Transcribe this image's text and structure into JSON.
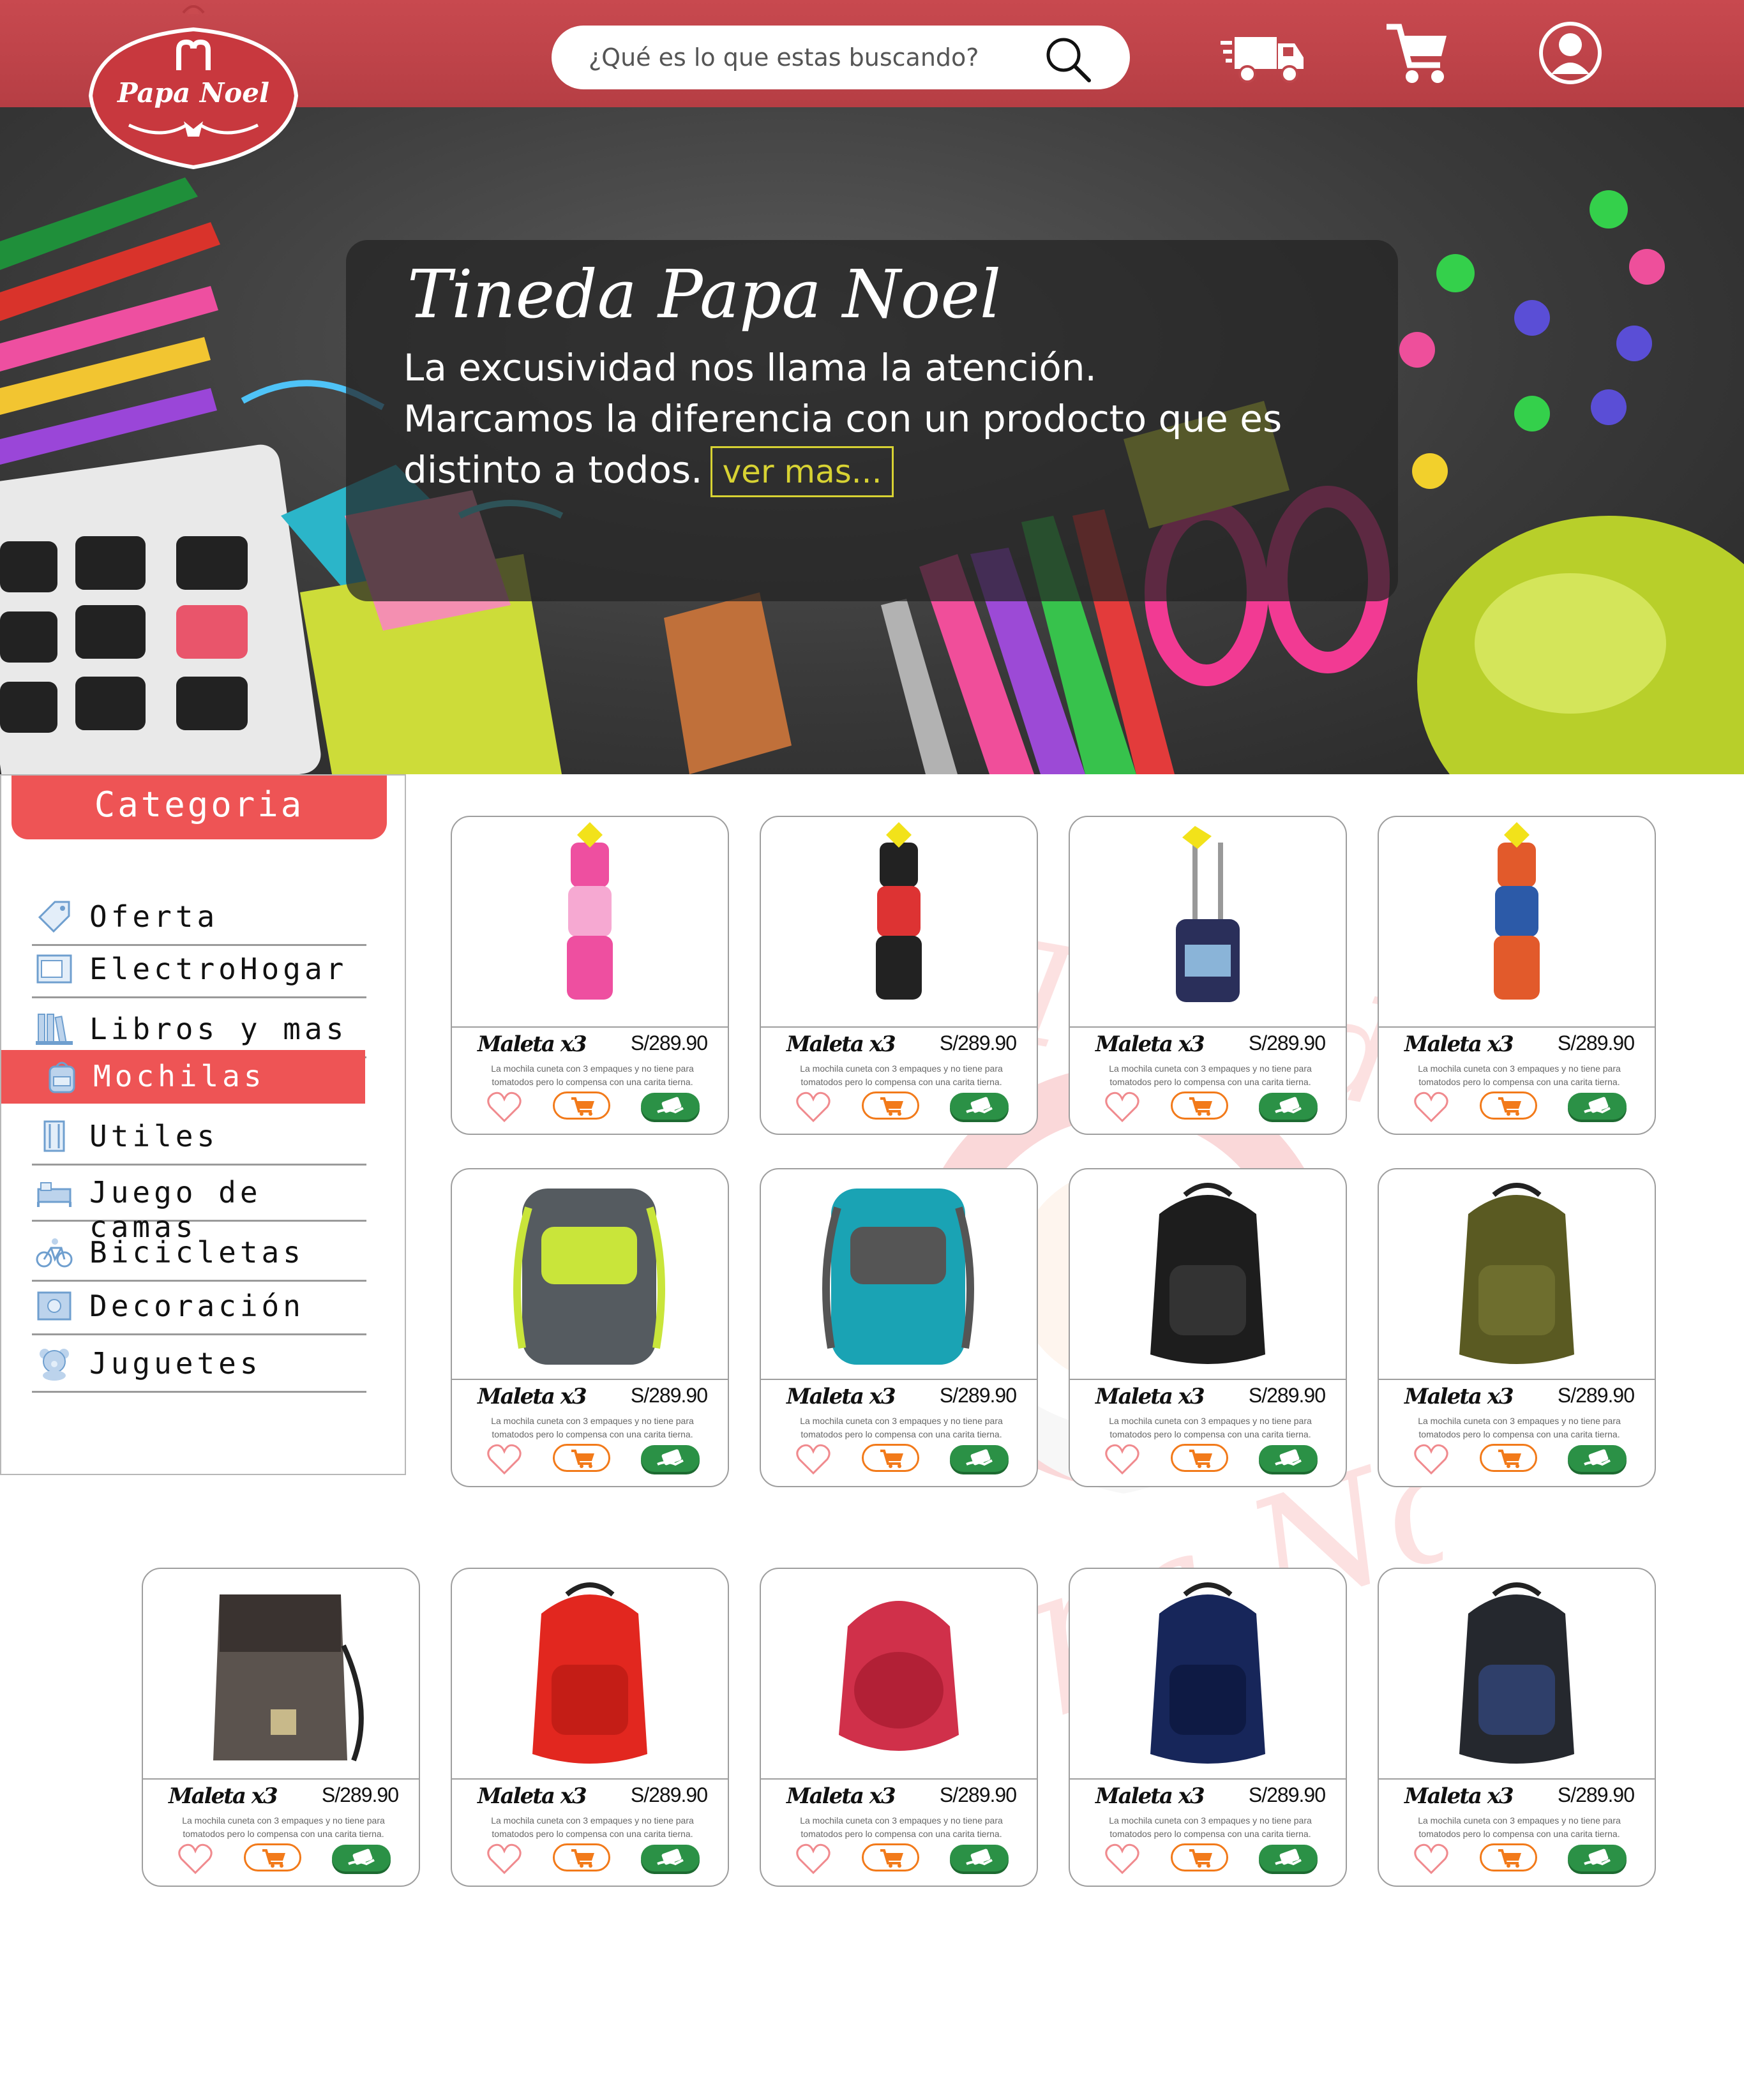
{
  "header": {
    "brand": "Papa Noel",
    "search_placeholder": "¿Qué es lo que estas buscando?",
    "icons": [
      "delivery-truck-icon",
      "cart-icon",
      "user-icon"
    ],
    "colors": {
      "bar": "#c0464c",
      "accent": "#ee5455",
      "buy": "#2b9146",
      "cart": "#f27a1a"
    }
  },
  "hero": {
    "title": "Tineda Papa Noel",
    "text": "La excusividad nos llama la atención. Marcamos la diferencia con un prodocto que es distinto a todos.",
    "cta": "ver mas..."
  },
  "sidebar": {
    "title": "Categoria",
    "items": [
      {
        "label": "Oferta",
        "icon": "tag-icon"
      },
      {
        "label": "ElectroHogar",
        "icon": "microwave-icon"
      },
      {
        "label": "Libros y mas",
        "icon": "books-icon"
      },
      {
        "label": "Mochilas",
        "icon": "backpack-icon",
        "active": true
      },
      {
        "label": "Utiles",
        "icon": "school-supplies-icon"
      },
      {
        "label": "Juego de camas",
        "icon": "bed-icon"
      },
      {
        "label": "Bicicletas",
        "icon": "bicycle-icon"
      },
      {
        "label": "Decoración",
        "icon": "frame-icon"
      },
      {
        "label": "Juguetes",
        "icon": "teddy-bear-icon"
      }
    ]
  },
  "products": [
    {
      "name": "Maleta x3",
      "price": "S/289.90",
      "desc": "La mochila cuneta con 3 empaques y no tiene para tomatodos pero lo compensa con una carita tierna."
    },
    {
      "name": "Maleta x3",
      "price": "S/289.90",
      "desc": "La mochila cuneta con 3 empaques y no tiene para tomatodos pero lo compensa con una carita tierna."
    },
    {
      "name": "Maleta x3",
      "price": "S/289.90",
      "desc": "La mochila cuneta con 3 empaques y no tiene para tomatodos pero lo compensa con una carita tierna."
    },
    {
      "name": "Maleta x3",
      "price": "S/289.90",
      "desc": "La mochila cuneta con 3 empaques y no tiene para tomatodos pero lo compensa con una carita tierna."
    },
    {
      "name": "Maleta x3",
      "price": "S/289.90",
      "desc": "La mochila cuneta con 3 empaques y no tiene para tomatodos pero lo compensa con una carita tierna."
    },
    {
      "name": "Maleta x3",
      "price": "S/289.90",
      "desc": "La mochila cuneta con 3 empaques y no tiene para tomatodos pero lo compensa con una carita tierna."
    },
    {
      "name": "Maleta x3",
      "price": "S/289.90",
      "desc": "La mochila cuneta con 3 empaques y no tiene para tomatodos pero lo compensa con una carita tierna."
    },
    {
      "name": "Maleta x3",
      "price": "S/289.90",
      "desc": "La mochila cuneta con 3 empaques y no tiene para tomatodos pero lo compensa con una carita tierna."
    },
    {
      "name": "Maleta x3",
      "price": "S/289.90",
      "desc": "La mochila cuneta con 3 empaques y no tiene para tomatodos pero lo compensa con una carita tierna."
    },
    {
      "name": "Maleta x3",
      "price": "S/289.90",
      "desc": "La mochila cuneta con 3 empaques y no tiene para tomatodos pero lo compensa con una carita tierna."
    },
    {
      "name": "Maleta x3",
      "price": "S/289.90",
      "desc": "La mochila cuneta con 3 empaques y no tiene para tomatodos pero lo compensa con una carita tierna."
    },
    {
      "name": "Maleta x3",
      "price": "S/289.90",
      "desc": "La mochila cuneta con 3 empaques y no tiene para tomatodos pero lo compensa con una carita tierna."
    },
    {
      "name": "Maleta x3",
      "price": "S/289.90",
      "desc": "La mochila cuneta con 3 empaques y no tiene para tomatodos pero lo compensa con una carita tierna."
    }
  ]
}
